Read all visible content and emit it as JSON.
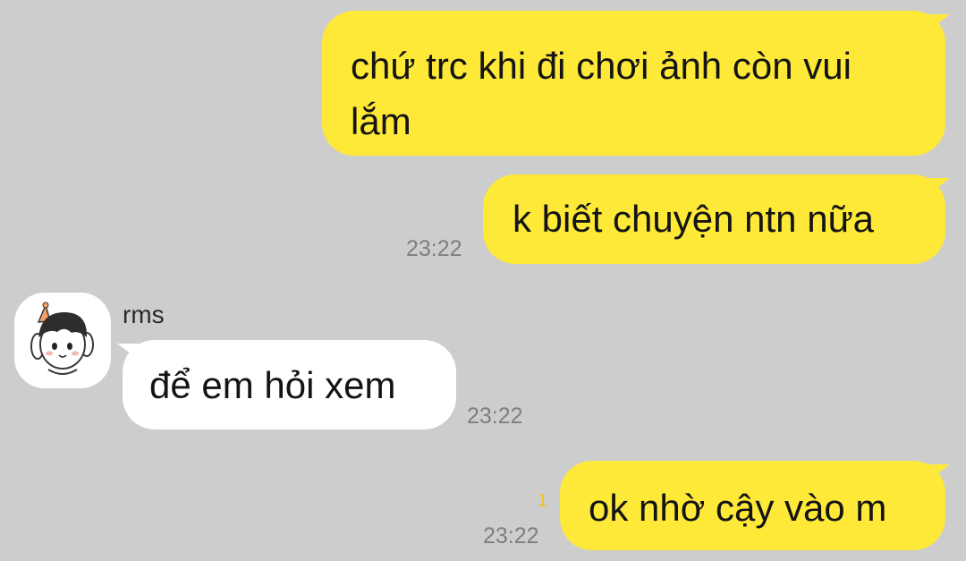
{
  "messages": [
    {
      "id": 1,
      "direction": "outgoing",
      "text": "chứ trc khi đi chơi ảnh còn vui lắm",
      "time": ""
    },
    {
      "id": 2,
      "direction": "outgoing",
      "text": "k biết chuyện ntn nữa",
      "time": "23:22"
    },
    {
      "id": 3,
      "direction": "incoming",
      "sender": "rms",
      "text": "để em hỏi xem",
      "time": "23:22"
    },
    {
      "id": 4,
      "direction": "outgoing",
      "text": "ok nhờ cậy vào m",
      "time": "23:22",
      "unread_count": "1"
    }
  ],
  "colors": {
    "background": "#cdcdcd",
    "outgoing_bubble": "#fee838",
    "incoming_bubble": "#ffffff",
    "timestamp": "#7f7f7f",
    "unread_indicator": "#e8c42a"
  },
  "icons": {
    "avatar": "cartoon-boy-with-party-hat-avatar"
  }
}
